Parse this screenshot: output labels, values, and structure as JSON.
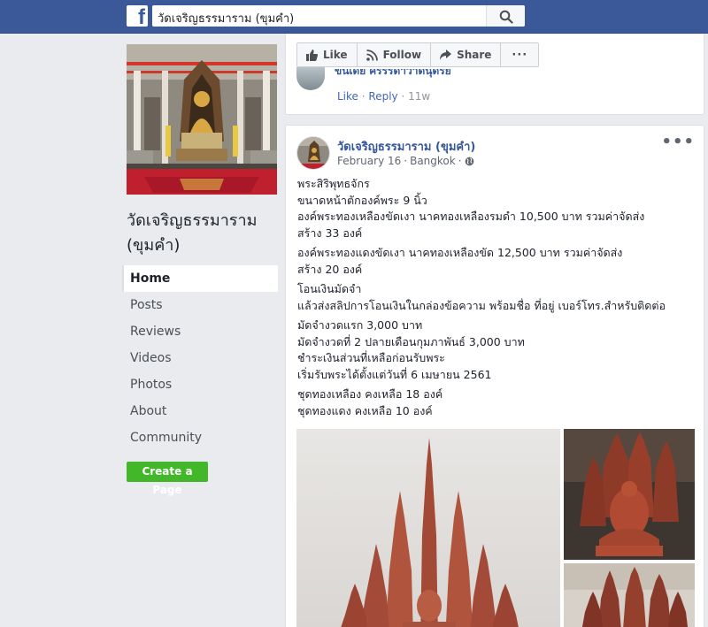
{
  "search": {
    "query": "วัดเจริญธรรมาราม (ขุมคำ)"
  },
  "icons": {
    "logo": "facebook-f-logo",
    "search": "magnifier-icon",
    "like": "thumbs-up-icon",
    "follow": "rss-icon",
    "share": "share-arrow-icon",
    "more": "ellipsis-icon",
    "globe": "globe-icon"
  },
  "colors": {
    "header": "#3b5998",
    "link": "#365899",
    "create_button": "#42b72a",
    "background": "#e9ebee"
  },
  "page": {
    "name": "วัดเจริญธรรมาราม (ขุมคำ)",
    "nav": [
      {
        "label": "Home",
        "active": true
      },
      {
        "label": "Posts"
      },
      {
        "label": "Reviews"
      },
      {
        "label": "Videos"
      },
      {
        "label": "Photos"
      },
      {
        "label": "About"
      },
      {
        "label": "Community"
      }
    ],
    "create_page": "Create a Page"
  },
  "actions": {
    "like": "Like",
    "follow": "Follow",
    "share": "Share",
    "more": "···"
  },
  "comment": {
    "name": "ขนเดย ศรรรดาวาดนุดรย",
    "like": "Like",
    "sep": "·",
    "reply": "Reply",
    "age": "11w"
  },
  "post": {
    "author": "วัดเจริญธรรมาราม (ขุมคำ)",
    "date": "February 16",
    "sep": "·",
    "location": "Bangkok",
    "more": "•••",
    "lines": [
      [
        "พระสิริพุทธจักร",
        "ขนาดหน้าตักองค์พระ 9 นิ้ว",
        "องค์พระทองเหลืองขัดเงา นาคทองเหลืองรมดำ 10,500 บาท รวมค่าจัดส่ง",
        "สร้าง 33 องค์"
      ],
      [
        "องค์พระทองแดงขัดเงา นาคทองเหลืองขัด 12,500 บาท รวมค่าจัดส่ง",
        "สร้าง 20 องค์"
      ],
      [
        "โอนเงินมัดจำ",
        "แล้วส่งสลิปการโอนเงินในกล่องข้อความ พร้อมชื่อ ที่อยู่ เบอร์โทร.สำหรับติดต่อ"
      ],
      [
        "มัดจำงวดแรก 3,000 บาท",
        "มัดจำงวดที่ 2 ปลายเดือนกุมภาพันธ์ 3,000 บาท",
        "ชำระเงินส่วนที่เหลือก่อนรับพระ",
        "เริ่มรับพระได้ตั้งแต่วันที่ 6 เมษายน 2561"
      ],
      [
        "ชุดทองเหลือง คงเหลือ 18 องค์",
        "ชุดทองแดง คงเหลือ 10 องค์"
      ]
    ]
  }
}
